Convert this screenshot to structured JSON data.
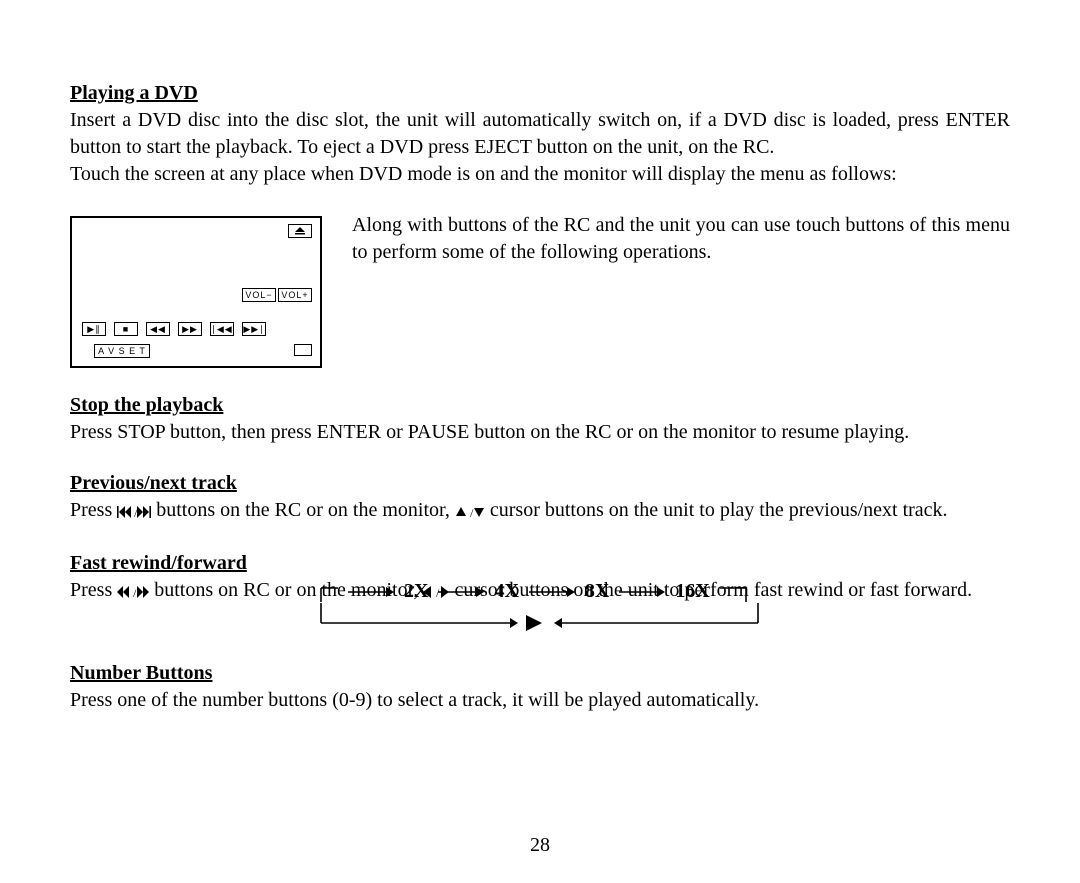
{
  "page_number": "28",
  "sections": {
    "playing": {
      "title": "Playing a DVD",
      "p1": "Insert a DVD disc into the disc slot, the unit will automatically switch on, if a DVD disc is loaded, press ENTER button to start the playback. To eject a DVD press EJECT button on the unit, on the RC.",
      "p2": "Touch the screen at any place when DVD mode is on and the monitor will display the menu as follows:",
      "aside": "Along with buttons of the RC and the unit you can use touch buttons of this menu to perform some of the following operations."
    },
    "stop": {
      "title": "Stop the playback",
      "body": "Press STOP button, then press ENTER or PAUSE button on the RC or on the monitor to resume playing."
    },
    "prevnext": {
      "title": "Previous/next track",
      "lead": "Press ",
      "mid1": " buttons on the RC or on the monitor, ",
      "mid2": " cursor buttons on the unit to play the previous/next track."
    },
    "fast": {
      "title": "Fast rewind/forward",
      "lead": "Press ",
      "mid1": " buttons on RC or on the monitor, ",
      "mid2": " cursor buttons on the unit to perform fast rewind or fast forward."
    },
    "number": {
      "title": "Number Buttons",
      "body": "Press one of the number buttons (0-9) to select a track, it will be played automatically."
    }
  },
  "touchscreen": {
    "eject_label": "⏏",
    "vol_minus": "VOL−",
    "vol_plus": "VOL+",
    "row": [
      "▶∥",
      "■",
      "◀◀",
      "▶▶",
      "∣◀◀",
      "▶▶∣"
    ],
    "av_set": "A V  S E T"
  },
  "inline_icons": {
    "prev_next": "ᐊᐊ/▶▶ᐅ",
    "up_down": "▲/▼",
    "rew_fwd": "◀◀/▶▶",
    "left_right": "◀ / ▶"
  },
  "speed_labels": [
    "2X",
    "4X",
    "8X",
    "16X"
  ]
}
